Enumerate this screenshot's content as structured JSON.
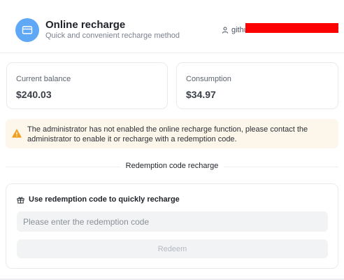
{
  "header": {
    "title": "Online recharge",
    "subtitle": "Quick and convenient recharge method",
    "icon": "credit-card-icon",
    "user_name": "githu",
    "accent_color": "#5fa8f5"
  },
  "stats": {
    "balance_label": "Current balance",
    "balance_value": "$240.03",
    "consumption_label": "Consumption",
    "consumption_value": "$34.97"
  },
  "warning": {
    "icon": "warning-triangle-icon",
    "color": "#f0a020",
    "text": "The administrator has not enabled the online recharge function, please contact the administrator to enable it or recharge with a redemption code."
  },
  "section": {
    "title": "Redemption code recharge"
  },
  "redeem": {
    "icon": "gift-icon",
    "title": "Use redemption code to quickly recharge",
    "input_placeholder": "Please enter the redemption code",
    "input_value": "",
    "button_label": "Redeem"
  }
}
